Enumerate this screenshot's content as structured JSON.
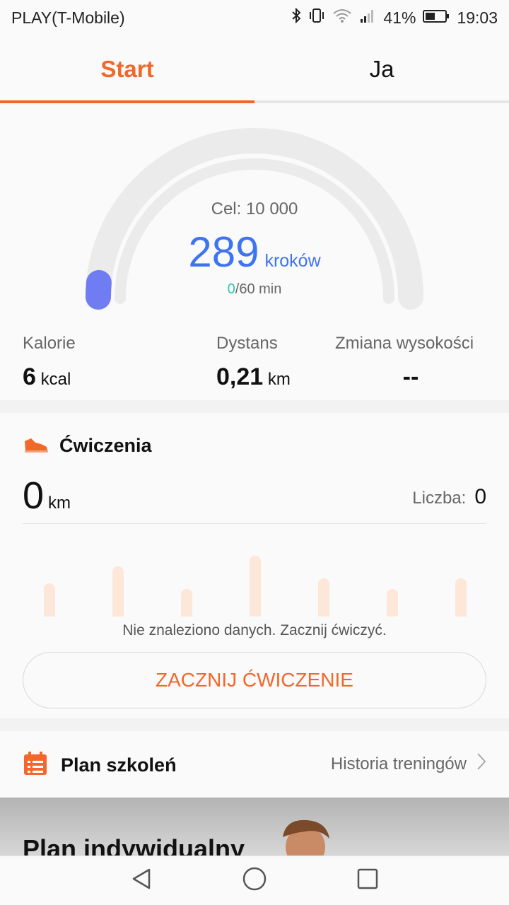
{
  "status_bar": {
    "carrier": "PLAY(T-Mobile)",
    "battery": "41%",
    "time": "19:03",
    "icons": [
      "bluetooth-icon",
      "vibrate-icon",
      "wifi-icon",
      "signal-icon",
      "battery-icon"
    ]
  },
  "tabs": [
    {
      "label": "Start",
      "active": true
    },
    {
      "label": "Ja",
      "active": false
    }
  ],
  "steps": {
    "goal_label": "Cel: 10 000",
    "value": "289",
    "unit": "kroków",
    "minutes_done": "0",
    "minutes_rest": "/60 min",
    "progress_fraction": 0.029
  },
  "stats": [
    {
      "label": "Kalorie",
      "value": "6",
      "unit": "kcal"
    },
    {
      "label": "Dystans",
      "value": "0,21",
      "unit": "km"
    },
    {
      "label": "Zmiana wysokości",
      "value": "--",
      "unit": ""
    }
  ],
  "exercise": {
    "title": "Ćwiczenia",
    "distance": "0",
    "distance_unit": "km",
    "count_label": "Liczba:",
    "count_value": "0",
    "no_data": "Nie znaleziono danych. Zacznij ćwiczyć.",
    "button": "ZACZNIJ ĆWICZENIE",
    "placeholder_bar_levels": [
      0.4,
      0.6,
      0.33,
      0.73,
      0.46,
      0.33,
      0.46
    ]
  },
  "plan": {
    "title": "Plan szkoleń",
    "history_link": "Historia treningów"
  },
  "banner": {
    "title": "Plan indywidualny"
  },
  "colors": {
    "accent": "#f2672a",
    "steps_blue": "#3f74f0",
    "minutes_green": "#2fc7a1",
    "gauge_track": "#ebebeb"
  }
}
